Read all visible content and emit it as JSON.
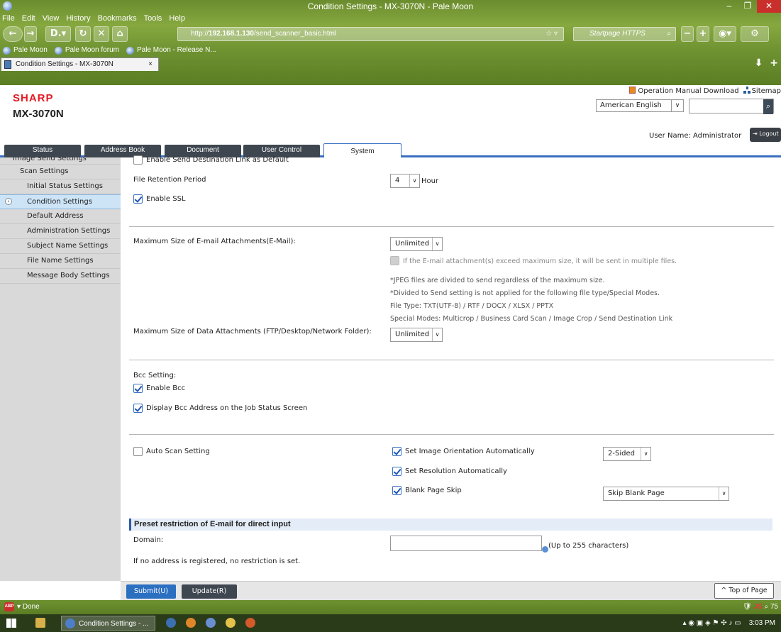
{
  "window": {
    "title": "Condition Settings - MX-3070N - Pale Moon",
    "minimize": "–",
    "maximize": "❐",
    "close": "✕"
  },
  "menu": [
    "File",
    "Edit",
    "View",
    "History",
    "Bookmarks",
    "Tools",
    "Help"
  ],
  "nav": {
    "url_prefix": "http://",
    "url_host": "192.168.1.130",
    "url_path": "/send_scanner_basic.html",
    "search_placeholder": "Startpage HTTPS"
  },
  "bookmarks": [
    "Pale Moon",
    "Pale Moon forum",
    "Pale Moon - Release N..."
  ],
  "tab": {
    "title": "Condition Settings - MX-3070N",
    "close": "×"
  },
  "header": {
    "logo": "SHARP",
    "model": "MX-3070N",
    "manual_link": "Operation Manual Download",
    "sitemap_link": "Sitemap",
    "language": "American English",
    "user_label": "User Name: Administrator",
    "logout": "Logout"
  },
  "main_tabs": [
    "Status",
    "Address Book",
    "Document",
    "User Control",
    "System"
  ],
  "sidebar": {
    "cut_item": "Image Send Settings",
    "items": [
      {
        "label": "Scan Settings",
        "level": 1
      },
      {
        "label": "Initial Status Settings",
        "level": 2
      },
      {
        "label": "Condition Settings",
        "level": 2,
        "active": true
      },
      {
        "label": "Default Address",
        "level": 2
      },
      {
        "label": "Administration Settings",
        "level": 2
      },
      {
        "label": "Subject Name Settings",
        "level": 2
      },
      {
        "label": "File Name Settings",
        "level": 2
      },
      {
        "label": "Message Body Settings",
        "level": 2
      }
    ]
  },
  "form": {
    "enable_send_dest_link_label": "Enable Send Destination Link as Default",
    "enable_send_dest_link_checked": false,
    "file_retention_label": "File Retention Period",
    "file_retention_value": "4",
    "file_retention_unit": "Hour",
    "enable_ssl_label": "Enable SSL",
    "enable_ssl_checked": true,
    "max_email_label": "Maximum Size of E-mail Attachments(E-Mail):",
    "max_email_value": "Unlimited",
    "split_label": "If the E-mail attachment(s) exceed maximum size, it will be sent in multiple files.",
    "note_jpeg": "*JPEG files are divided to send regardless of the maximum size.",
    "note_divided": "*Divided to Send setting is not applied for the following file type/Special Modes.",
    "note_file_type": "File Type: TXT(UTF-8) / RTF / DOCX / XLSX / PPTX",
    "note_special_modes": "Special Modes: Multicrop / Business Card Scan / Image Crop / Send Destination Link",
    "max_data_label": "Maximum Size of Data Attachments (FTP/Desktop/Network Folder):",
    "max_data_value": "Unlimited",
    "bcc_setting_label": "Bcc Setting:",
    "enable_bcc_label": "Enable Bcc",
    "enable_bcc_checked": true,
    "display_bcc_label": "Display Bcc Address on the Job Status Screen",
    "display_bcc_checked": true,
    "auto_scan_label": "Auto Scan Setting",
    "auto_scan_checked": false,
    "orientation_label": "Set Image Orientation Automatically",
    "orientation_checked": true,
    "orientation_value": "2-Sided",
    "resolution_label": "Set Resolution Automatically",
    "resolution_checked": true,
    "blank_skip_label": "Blank Page Skip",
    "blank_skip_checked": true,
    "blank_skip_value": "Skip Blank Page",
    "preset_heading": "Preset restriction of E-mail for direct input",
    "domain_label": "Domain:",
    "domain_value": "",
    "domain_hint": "(Up to 255 characters)",
    "no_restriction_note": "If no address is registered, no restriction is set."
  },
  "actions": {
    "submit": "Submit(U)",
    "update": "Update(R)",
    "top_of_page": "^ Top of Page"
  },
  "status": {
    "text": "Done",
    "js": "JS",
    "zoom": "75"
  },
  "taskbar": {
    "active_item": "Condition Settings - ...",
    "time": "3:03 PM"
  },
  "colors": {
    "sharp_red": "#e21b24",
    "accent_blue": "#2b6fc1",
    "sidebar_bg": "#d9d9d9",
    "tab_dark": "#3e4650",
    "browser_green": "#6e9231"
  }
}
